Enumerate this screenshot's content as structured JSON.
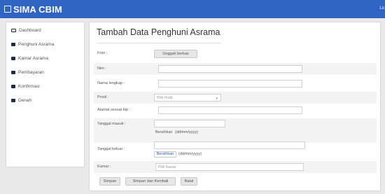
{
  "app": {
    "title": "SIMA CBIM",
    "logout_label": "Lo"
  },
  "sidebar": {
    "items": [
      {
        "label": "Dashboard",
        "icon": "monitor-icon"
      },
      {
        "label": "Penghuni Asrama",
        "icon": "table-icon"
      },
      {
        "label": "Kamar Asrama",
        "icon": "table-icon"
      },
      {
        "label": "Pembayaran",
        "icon": "table-icon"
      },
      {
        "label": "Konfirmasi",
        "icon": "table-icon"
      },
      {
        "label": "Denah",
        "icon": "table-icon"
      }
    ]
  },
  "page": {
    "title": "Tambah Data Penghuni Asrama"
  },
  "form": {
    "foto": {
      "label": "Foto :",
      "button": "Unggah berkas"
    },
    "nim": {
      "label": "Nim :",
      "value": ""
    },
    "nama": {
      "label": "Nama lengkap :",
      "value": ""
    },
    "prodi": {
      "label": "Prodi :",
      "selected": "Pilih Prodi"
    },
    "alamat": {
      "label": "Alamat sesuai ktp :",
      "value": ""
    },
    "masuk": {
      "label": "Tanggal masuk :",
      "clear": "Bersihkan",
      "format": "(dd/mm/yyyy)"
    },
    "keluar": {
      "label": "Tanggal keluar :",
      "clear": "Bersihkan",
      "format": "(dd/mm/yyyy)"
    },
    "kamar": {
      "label": "Kamar :",
      "placeholder": "Pilih Kamar"
    }
  },
  "actions": {
    "save": "Simpan",
    "save_back": "Simpan dan Kembali",
    "cancel": "Batal"
  }
}
